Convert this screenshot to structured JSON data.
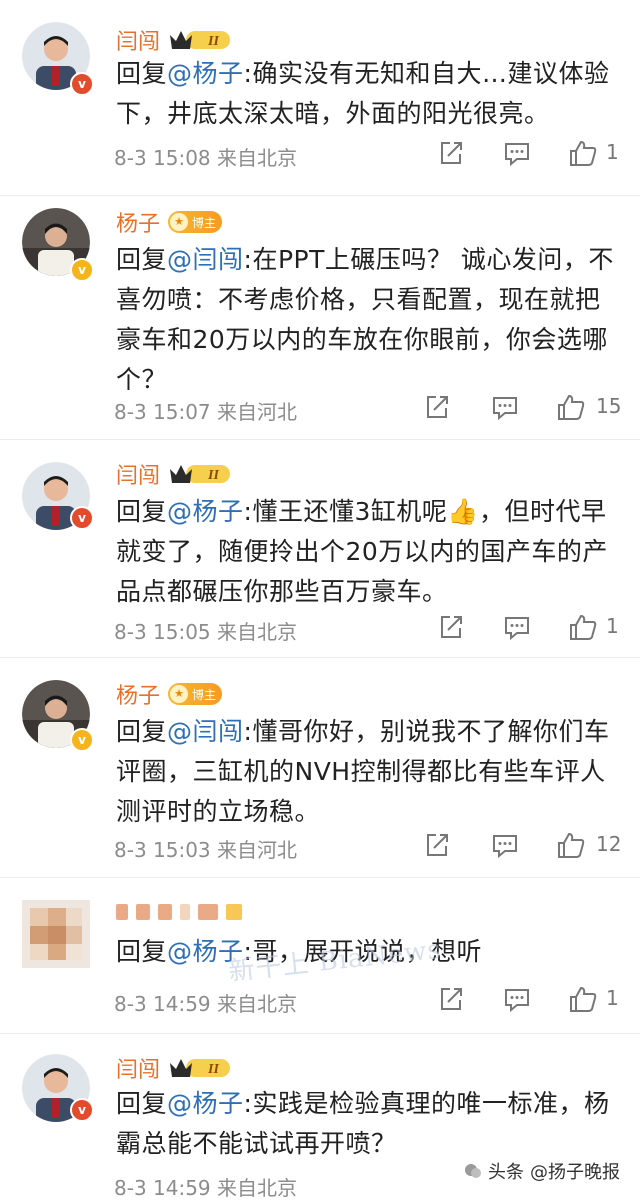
{
  "comments": [
    {
      "name": "闫闯",
      "badge": "crown",
      "level": "II",
      "mention": "@杨子",
      "text": ":确实没有无知和自大…建议体验下，井底太深太暗，外面的阳光很亮。",
      "time": "8-3 15:08",
      "location": "来自北京",
      "likes": "1",
      "text_lines": [
        "回复@杨子:确实没有无知和自大…建议体",
        "验下，井底太深太暗，外面的阳光很亮。"
      ]
    },
    {
      "name": "杨子",
      "badge": "blogger",
      "blogger_label": "博主",
      "mention": "@闫闯",
      "text": ":在PPT上碾压吗？ 诚心发问，不喜勿喷：不考虑价格，只看配置，现在就把豪车和20万以内的车放在你眼前，你会选哪个？",
      "time": "8-3 15:07",
      "location": "来自河北",
      "likes": "15"
    },
    {
      "name": "闫闯",
      "badge": "crown",
      "level": "II",
      "mention": "@杨子",
      "text": ":懂王还懂3缸机呢👍，但时代早就变了，随便拎出个20万以内的国产车的产品点都碾压你那些百万豪车。",
      "time": "8-3 15:05",
      "location": "来自北京",
      "likes": "1"
    },
    {
      "name": "杨子",
      "badge": "blogger",
      "blogger_label": "博主",
      "mention": "@闫闯",
      "text": ":懂哥你好，别说我不了解你们车评圈，三缸机的NVH控制得都比有些车评人测评时的立场稳。",
      "time": "8-3 15:03",
      "location": "来自河北",
      "likes": "12"
    },
    {
      "name": "",
      "badge": "blurred",
      "mention": "@杨子",
      "text": ":哥，展开说说，想听",
      "time": "8-3 14:59",
      "location": "来自北京",
      "likes": "1"
    },
    {
      "name": "闫闯",
      "badge": "crown",
      "level": "II",
      "mention": "@杨子",
      "text": ":实践是检验真理的唯一标准，杨霸总能不能试试再开喷？",
      "time": "8-3 14:59",
      "location": "来自北京",
      "likes": ""
    }
  ],
  "reply_prefix": "回复",
  "watermark": "新干上 BiaNews",
  "footer": {
    "source": "头条",
    "account": "@扬子晚报"
  },
  "colors": {
    "name": "#e8702a",
    "mention": "#2e6fb8",
    "meta": "#8c8c8c",
    "divider": "#ececec"
  },
  "icons": {
    "share": "share-icon",
    "comment": "comment-icon",
    "like": "thumbs-up-icon"
  }
}
